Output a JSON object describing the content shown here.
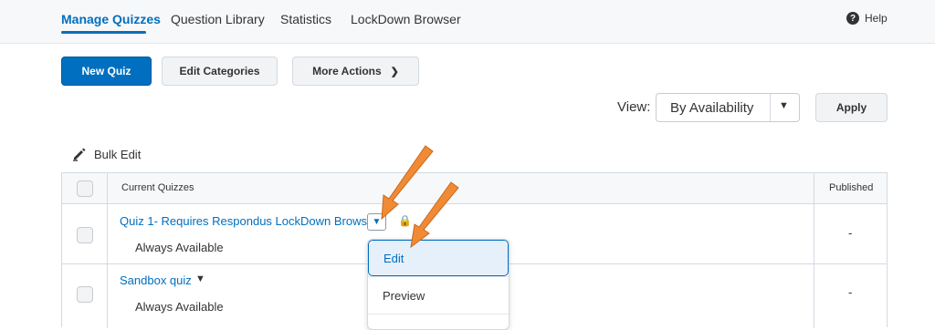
{
  "tabs": [
    {
      "label": "Manage Quizzes",
      "active": true
    },
    {
      "label": "Question Library",
      "active": false
    },
    {
      "label": "Statistics",
      "active": false
    },
    {
      "label": "LockDown Browser",
      "active": false
    }
  ],
  "help": {
    "label": "Help",
    "icon": "help-circle-icon"
  },
  "actions": {
    "new_quiz": "New Quiz",
    "edit_categories": "Edit Categories",
    "more_actions": "More Actions"
  },
  "view": {
    "label": "View:",
    "selected": "By Availability",
    "apply": "Apply"
  },
  "bulk_edit": {
    "label": "Bulk Edit",
    "icon": "pencil-icon"
  },
  "table": {
    "headers": {
      "name": "Current Quizzes",
      "published": "Published"
    },
    "rows": [
      {
        "title": "Quiz 1- Requires Respondus LockDown Browser",
        "availability": "Always Available",
        "published": "-"
      },
      {
        "title": "Sandbox quiz",
        "availability": "Always Available",
        "published": "-"
      }
    ]
  },
  "context_menu": {
    "items": [
      "Edit",
      "Preview"
    ],
    "highlighted": "Edit"
  },
  "annotation": {
    "arrow_color": "#f08a35"
  },
  "colors": {
    "accent": "#006fbf"
  }
}
